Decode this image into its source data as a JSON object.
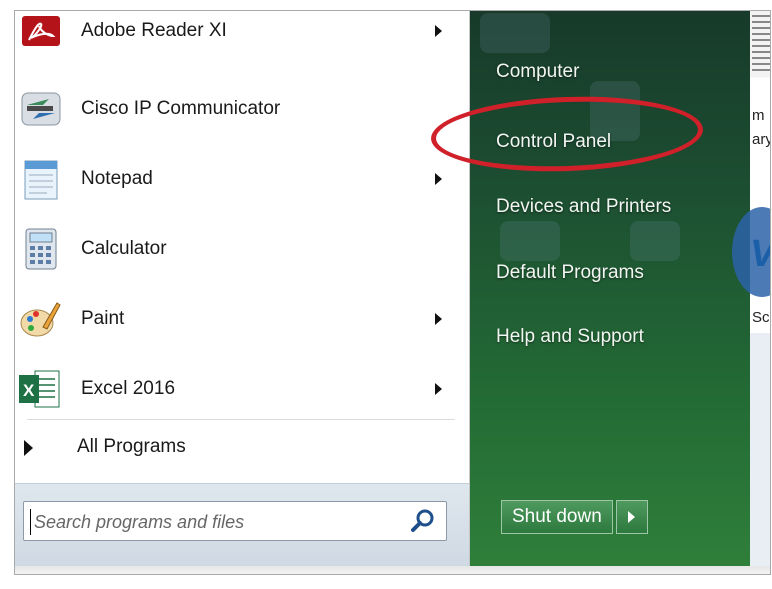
{
  "programs": [
    {
      "label": "Adobe Reader XI",
      "icon": "adobe-reader-icon",
      "has_submenu": true
    },
    {
      "label": "Cisco IP Communicator",
      "icon": "cisco-ip-communicator-icon",
      "has_submenu": false
    },
    {
      "label": "Notepad",
      "icon": "notepad-icon",
      "has_submenu": true
    },
    {
      "label": "Calculator",
      "icon": "calculator-icon",
      "has_submenu": false
    },
    {
      "label": "Paint",
      "icon": "paint-icon",
      "has_submenu": true
    },
    {
      "label": "Excel 2016",
      "icon": "excel-icon",
      "has_submenu": true
    }
  ],
  "all_programs": {
    "label": "All Programs"
  },
  "search": {
    "placeholder": "Search programs and files"
  },
  "right_links": [
    {
      "label": "Computer"
    },
    {
      "label": "Control Panel",
      "highlighted": true
    },
    {
      "label": "Devices and Printers"
    },
    {
      "label": "Default Programs"
    },
    {
      "label": "Help and Support"
    }
  ],
  "shutdown": {
    "label": "Shut down"
  },
  "desktop_fragments": {
    "a": "m",
    "b": "ary",
    "c": "VS",
    "d": "Sc"
  },
  "colors": {
    "highlight_oval": "#d0202a",
    "right_panel": "#236b35",
    "accent_blue": "#1b5fa8"
  }
}
